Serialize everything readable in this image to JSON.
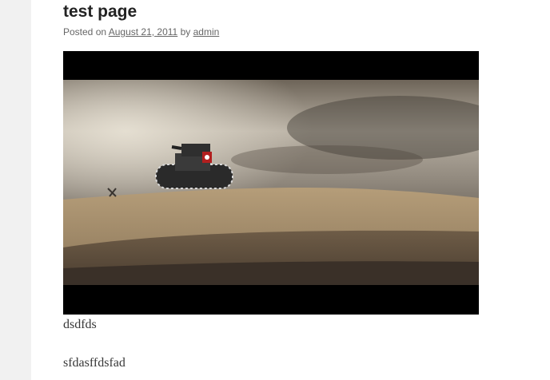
{
  "post": {
    "title": "test page",
    "meta": {
      "posted_on_prefix": "Posted on",
      "date": "August 21, 2011",
      "by": "by",
      "author": "admin"
    },
    "video": {
      "scene": "tank-on-desert-hill-icon"
    },
    "paragraphs": [
      "dsdfds",
      "sfdasffdsfad"
    ]
  }
}
